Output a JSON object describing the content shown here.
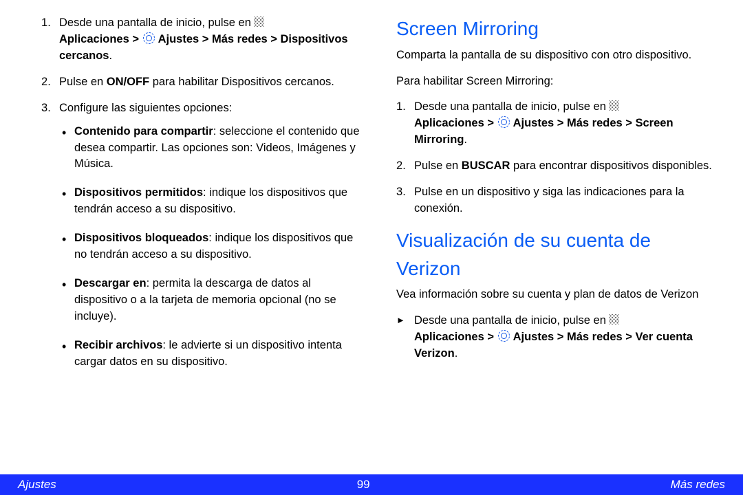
{
  "left": {
    "ol": [
      {
        "pre": "Desde una pantalla de inicio, pulse en ",
        "pathA": "Aplicaciones > ",
        "pathB": " Ajustes > Más redes > Dispositivos cercanos",
        "post": "."
      },
      {
        "pre": "Pulse en ",
        "bold": "ON/OFF",
        "post": " para habilitar Dispositivos cercanos."
      },
      {
        "text": "Configure las siguientes opciones:"
      }
    ],
    "ul": [
      {
        "bold": "Contenido para compartir",
        "rest": ": seleccione el contenido que desea compartir. Las opciones son: Videos, Imágenes y Música."
      },
      {
        "bold": "Dispositivos permitidos",
        "rest": ": indique los dispositivos que tendrán acceso a su dispositivo."
      },
      {
        "bold": "Dispositivos bloqueados",
        "rest": ": indique los dispositivos que no tendrán acceso a su dispositivo."
      },
      {
        "bold": "Descargar en",
        "rest": ": permita la descarga de datos al dispositivo o a la tarjeta de memoria opcional (no se incluye)."
      },
      {
        "bold": "Recibir archivos",
        "rest": ": le advierte si un dispositivo intenta cargar datos en su dispositivo."
      }
    ]
  },
  "right": {
    "s1_title": "Screen Mirroring",
    "s1_intro": "Comparta la pantalla de su dispositivo con otro dispositivo.",
    "s1_lead": "Para habilitar Screen Mirroring:",
    "s1_ol": [
      {
        "pre": "Desde una pantalla de inicio, pulse en ",
        "pathA": "Aplicaciones > ",
        "pathB": " Ajustes > Más redes > Screen Mirroring",
        "post": "."
      },
      {
        "pre": "Pulse en ",
        "bold": "BUSCAR",
        "post": " para encontrar dispositivos disponibles."
      },
      {
        "text": "Pulse en un dispositivo y siga las indicaciones para la conexión."
      }
    ],
    "s2_title": "Visualización de su cuenta de Verizon",
    "s2_intro": "Vea información sobre su cuenta y plan de datos de Verizon",
    "s2_arrow": {
      "pre": "Desde una pantalla de inicio, pulse en ",
      "pathA": "Aplicaciones > ",
      "pathB": " Ajustes > Más redes > Ver cuenta Verizon",
      "post": "."
    }
  },
  "footer": {
    "left": "Ajustes",
    "page": "99",
    "right": "Más redes"
  }
}
